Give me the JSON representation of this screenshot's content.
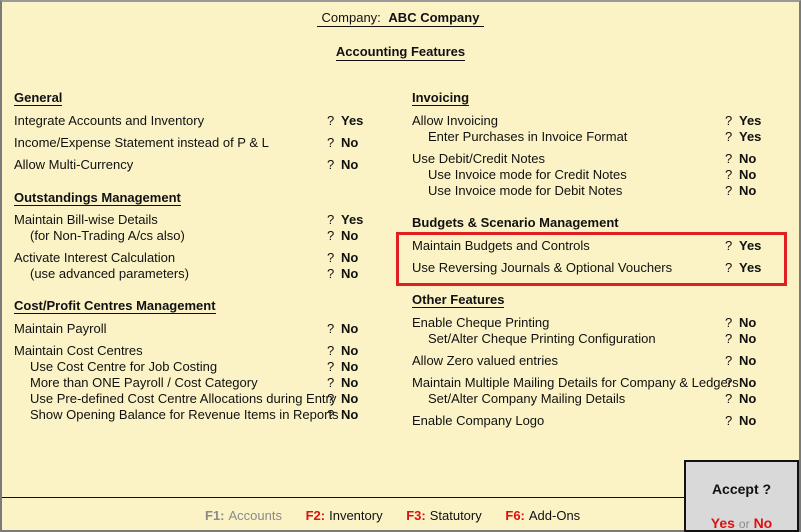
{
  "header": {
    "company_label": "Company:",
    "company_name": "ABC Company",
    "page_title": "Accounting Features"
  },
  "left": {
    "general": {
      "title": "General",
      "items": [
        {
          "label": "Integrate Accounts and Inventory",
          "value": "Yes"
        },
        {
          "label": "Income/Expense Statement instead of P & L",
          "value": "No"
        },
        {
          "label": "Allow Multi-Currency",
          "value": "No"
        }
      ]
    },
    "outstandings": {
      "title": "Outstandings Management",
      "items": [
        {
          "label": "Maintain Bill-wise Details",
          "value": "Yes"
        },
        {
          "label": "(for Non-Trading A/cs also)",
          "value": "No"
        },
        {
          "label": "Activate Interest Calculation",
          "value": "No"
        },
        {
          "label": "(use advanced parameters)",
          "value": "No"
        }
      ]
    },
    "cost": {
      "title": "Cost/Profit Centres Management",
      "items": [
        {
          "label": "Maintain Payroll",
          "value": "No"
        },
        {
          "label": "Maintain Cost Centres",
          "value": "No"
        },
        {
          "label": "Use Cost Centre for Job Costing",
          "value": "No"
        },
        {
          "label": "More than ONE Payroll / Cost Category",
          "value": "No"
        },
        {
          "label": "Use Pre-defined Cost Centre Allocations during Entry",
          "value": "No"
        },
        {
          "label": "Show Opening Balance for Revenue Items in Reports",
          "value": "No"
        }
      ]
    }
  },
  "right": {
    "invoicing": {
      "title": "Invoicing",
      "items": [
        {
          "label": "Allow Invoicing",
          "value": "Yes"
        },
        {
          "label": "Enter Purchases in Invoice Format",
          "value": "Yes"
        },
        {
          "label": "Use Debit/Credit Notes",
          "value": "No"
        },
        {
          "label": "Use Invoice mode for Credit Notes",
          "value": "No"
        },
        {
          "label": "Use Invoice mode for Debit Notes",
          "value": "No"
        }
      ]
    },
    "budgets": {
      "title": "Budgets & Scenario Management",
      "items": [
        {
          "label": "Maintain Budgets and Controls",
          "value": "Yes"
        },
        {
          "label": "Use Reversing Journals & Optional Vouchers",
          "value": "Yes"
        }
      ]
    },
    "other": {
      "title": "Other Features",
      "items": [
        {
          "label": "Enable Cheque Printing",
          "value": "No"
        },
        {
          "label": "Set/Alter Cheque Printing Configuration",
          "value": "No"
        },
        {
          "label": "Allow Zero valued entries",
          "value": "No"
        },
        {
          "label": "Maintain Multiple Mailing Details for Company & Ledgers",
          "value": "No"
        },
        {
          "label": "Set/Alter Company Mailing Details",
          "value": "No"
        },
        {
          "label": "Enable Company Logo",
          "value": "No"
        }
      ]
    }
  },
  "question_mark": "?",
  "footer": {
    "keys": [
      {
        "key": "F1:",
        "label": "Accounts",
        "enabled": false
      },
      {
        "key": "F2:",
        "label": "Inventory",
        "enabled": true
      },
      {
        "key": "F3:",
        "label": "Statutory",
        "enabled": true
      },
      {
        "key": "F6:",
        "label": "Add-Ons",
        "enabled": true
      }
    ]
  },
  "accept": {
    "title": "Accept ?",
    "yes": "Yes",
    "or": "or",
    "no": "No"
  },
  "colors": {
    "background": "#fbf3c6",
    "accent_red": "#dd1111",
    "highlight_border": "#e02020",
    "disabled_text": "#8a8a8a",
    "accept_panel": "#d9d9d9"
  }
}
